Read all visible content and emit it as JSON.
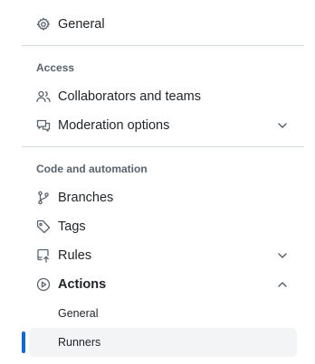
{
  "nav": {
    "general": {
      "label": "General",
      "icon": "gear-icon"
    },
    "sections": {
      "access": {
        "heading": "Access"
      },
      "code_automation": {
        "heading": "Code and automation"
      }
    },
    "collaborators": {
      "label": "Collaborators and teams",
      "icon": "people-icon"
    },
    "moderation": {
      "label": "Moderation options",
      "icon": "comment-discussion-icon",
      "expanded": false
    },
    "branches": {
      "label": "Branches",
      "icon": "git-branch-icon"
    },
    "tags": {
      "label": "Tags",
      "icon": "tag-icon"
    },
    "rules": {
      "label": "Rules",
      "icon": "repo-push-icon",
      "expanded": false
    },
    "actions": {
      "label": "Actions",
      "icon": "play-icon",
      "expanded": true,
      "children": [
        {
          "label": "General",
          "active": false
        },
        {
          "label": "Runners",
          "active": true
        }
      ]
    }
  },
  "colors": {
    "accent": "#0969da",
    "active_bg": "#f3f4f6",
    "muted": "#59636e",
    "divider": "#d1d9e0"
  }
}
